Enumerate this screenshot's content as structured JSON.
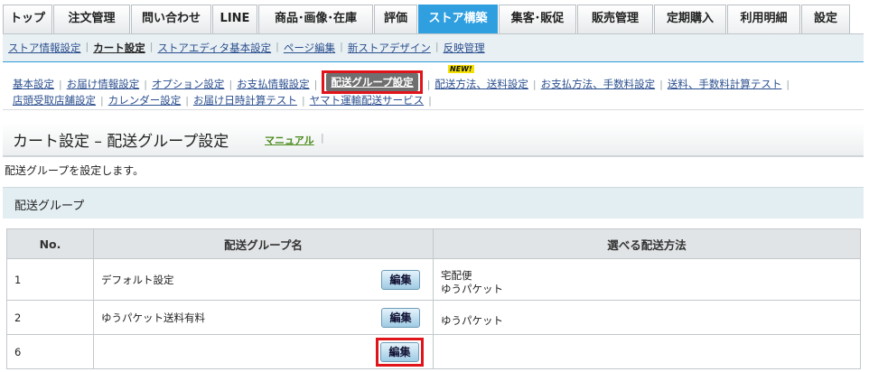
{
  "tabs": [
    {
      "label": "トップ",
      "w": 55
    },
    {
      "label": "注文管理",
      "w": 85
    },
    {
      "label": "問い合わせ",
      "w": 89
    },
    {
      "label": "LINE",
      "w": 50
    },
    {
      "label": "商品･画像･在庫",
      "w": 127
    },
    {
      "label": "評価",
      "w": 48
    },
    {
      "label": "ストア構築",
      "w": 88,
      "state": "active"
    },
    {
      "label": "集客･販促",
      "w": 86
    },
    {
      "label": "販売管理",
      "w": 84
    },
    {
      "label": "定期購入",
      "w": 80
    },
    {
      "label": "利用明細",
      "w": 81,
      "state": "current"
    },
    {
      "label": "設定",
      "w": 54
    }
  ],
  "subnav": [
    {
      "label": "ストア情報設定"
    },
    {
      "label": "カート設定",
      "bold": true
    },
    {
      "label": "ストアエディタ基本設定"
    },
    {
      "label": "ページ編集"
    },
    {
      "label": "新ストアデザイン"
    },
    {
      "label": "反映管理"
    }
  ],
  "cart_links_row1": [
    {
      "label": "基本設定"
    },
    {
      "label": "お届け情報設定"
    },
    {
      "label": "オプション設定"
    },
    {
      "label": "お支払情報設定"
    },
    {
      "label": "配送グループ設定",
      "active": true
    },
    {
      "label": "配送方法、送料設定",
      "new": true
    },
    {
      "label": "お支払方法、手数料設定"
    },
    {
      "label": "送料、手数料計算テスト"
    }
  ],
  "cart_links_row2": [
    {
      "label": "店頭受取店舗設定"
    },
    {
      "label": "カレンダー設定"
    },
    {
      "label": "お届け日時計算テスト"
    },
    {
      "label": "ヤマト運輸配送サービス"
    }
  ],
  "new_badge": "NEW!",
  "page": {
    "title": "カート設定 – 配送グループ設定",
    "manual": "マニュアル",
    "sep": "|",
    "description": "配送グループを設定します。",
    "section": "配送グループ"
  },
  "table": {
    "headers": {
      "no": "No.",
      "name": "配送グループ名",
      "methods": "選べる配送方法"
    },
    "edit_label": "編集",
    "rows": [
      {
        "no": "1",
        "name": "デフォルト設定",
        "methods": [
          "宅配便",
          "ゆうパケット"
        ],
        "h": 46
      },
      {
        "no": "2",
        "name": "ゆうパケット送料有料",
        "methods": [
          "ゆうパケット"
        ],
        "h": 38
      },
      {
        "no": "6",
        "name": "",
        "methods": [],
        "h": 38,
        "highlight": true
      }
    ]
  }
}
